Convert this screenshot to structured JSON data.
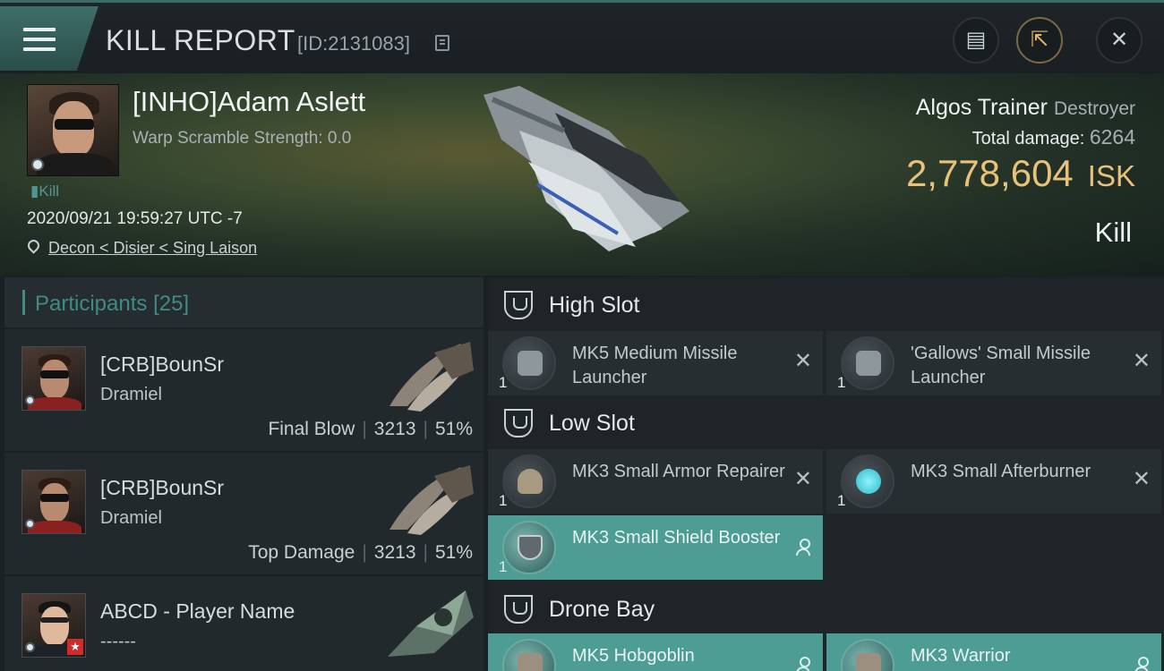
{
  "header": {
    "title": "KILL REPORT",
    "report_id": "[ID:2131083]"
  },
  "victim": {
    "name": "[INHO]Adam Aslett",
    "warp_scramble": "Warp Scramble Strength: 0.0",
    "kill_tag": "Kill",
    "datetime": "2020/09/21 19:59:27 UTC -7",
    "location": "Decon < Disier < Sing Laison"
  },
  "ship": {
    "name": "Algos Trainer",
    "class": "Destroyer",
    "total_damage_label": "Total damage:",
    "total_damage": "6264",
    "isk_value": "2,778,604",
    "isk_unit": "ISK",
    "result": "Kill"
  },
  "participants": {
    "label": "Participants",
    "count": "[25]",
    "items": [
      {
        "name": "[CRB]BounSr",
        "ship": "Dramiel",
        "role": "Final Blow",
        "damage": "3213",
        "percent": "51%"
      },
      {
        "name": "[CRB]BounSr",
        "ship": "Dramiel",
        "role": "Top Damage",
        "damage": "3213",
        "percent": "51%"
      },
      {
        "name": "ABCD - Player Name",
        "ship": "------"
      }
    ]
  },
  "fitting": {
    "high_slot": {
      "label": "High Slot",
      "modules": [
        {
          "name": "MK5 Medium Missile Launcher",
          "qty": "1"
        },
        {
          "name": "'Gallows' Small Missile Launcher",
          "qty": "1"
        }
      ]
    },
    "low_slot": {
      "label": "Low Slot",
      "modules": [
        {
          "name": "MK3 Small Armor Repairer",
          "qty": "1"
        },
        {
          "name": "MK3 Small Afterburner",
          "qty": "1"
        },
        {
          "name": "MK3 Small Shield Booster",
          "qty": "1"
        }
      ]
    },
    "drone_bay": {
      "label": "Drone Bay",
      "modules": [
        {
          "name": "MK5 Hobgoblin"
        },
        {
          "name": "MK3 Warrior"
        }
      ]
    }
  },
  "colors": {
    "accent": "#4d9d95",
    "isk": "#e8c27a"
  }
}
